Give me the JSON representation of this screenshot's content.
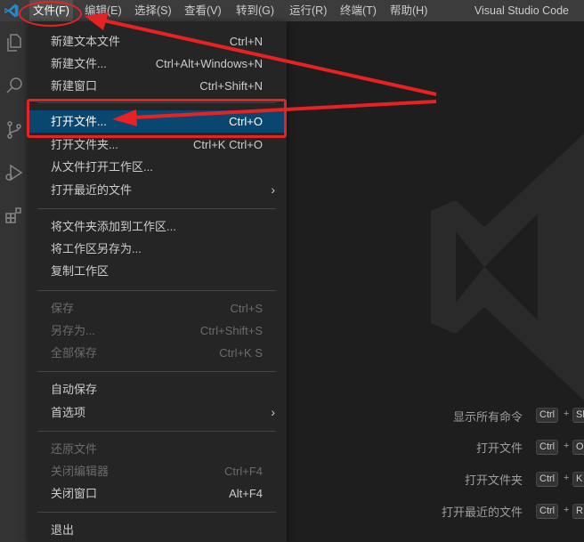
{
  "menubar": {
    "items": [
      "文件(F)",
      "编辑(E)",
      "选择(S)",
      "查看(V)",
      "转到(G)",
      "运行(R)",
      "终端(T)",
      "帮助(H)"
    ],
    "app_title": "Visual Studio Code"
  },
  "activity_bar": {
    "icons": [
      "explorer-icon",
      "search-icon",
      "source-control-icon",
      "run-debug-icon",
      "extensions-icon"
    ]
  },
  "file_menu": {
    "items": [
      {
        "label": "新建文本文件",
        "shortcut": "Ctrl+N"
      },
      {
        "label": "新建文件...",
        "shortcut": "Ctrl+Alt+Windows+N"
      },
      {
        "label": "新建窗口",
        "shortcut": "Ctrl+Shift+N"
      },
      {
        "label": "打开文件...",
        "shortcut": "Ctrl+O"
      },
      {
        "label": "打开文件夹...",
        "shortcut": "Ctrl+K Ctrl+O"
      },
      {
        "label": "从文件打开工作区...",
        "shortcut": ""
      },
      {
        "label": "打开最近的文件",
        "shortcut": ""
      },
      {
        "label": "将文件夹添加到工作区...",
        "shortcut": ""
      },
      {
        "label": "将工作区另存为...",
        "shortcut": ""
      },
      {
        "label": "复制工作区",
        "shortcut": ""
      },
      {
        "label": "保存",
        "shortcut": "Ctrl+S"
      },
      {
        "label": "另存为...",
        "shortcut": "Ctrl+Shift+S"
      },
      {
        "label": "全部保存",
        "shortcut": "Ctrl+K S"
      },
      {
        "label": "自动保存",
        "shortcut": ""
      },
      {
        "label": "首选项",
        "shortcut": ""
      },
      {
        "label": "还原文件",
        "shortcut": ""
      },
      {
        "label": "关闭编辑器",
        "shortcut": "Ctrl+F4"
      },
      {
        "label": "关闭窗口",
        "shortcut": "Alt+F4"
      },
      {
        "label": "退出",
        "shortcut": ""
      }
    ]
  },
  "editor_hints": [
    {
      "label": "显示所有命令",
      "keys": [
        "Ctrl",
        "Sh"
      ]
    },
    {
      "label": "打开文件",
      "keys": [
        "Ctrl",
        "O"
      ]
    },
    {
      "label": "打开文件夹",
      "keys": [
        "Ctrl",
        "K"
      ]
    },
    {
      "label": "打开最近的文件",
      "keys": [
        "Ctrl",
        "R"
      ]
    }
  ],
  "hint_plus": "+",
  "colors": {
    "annotation": "#e62222",
    "highlight": "#094771",
    "accent": "#0078d4"
  }
}
